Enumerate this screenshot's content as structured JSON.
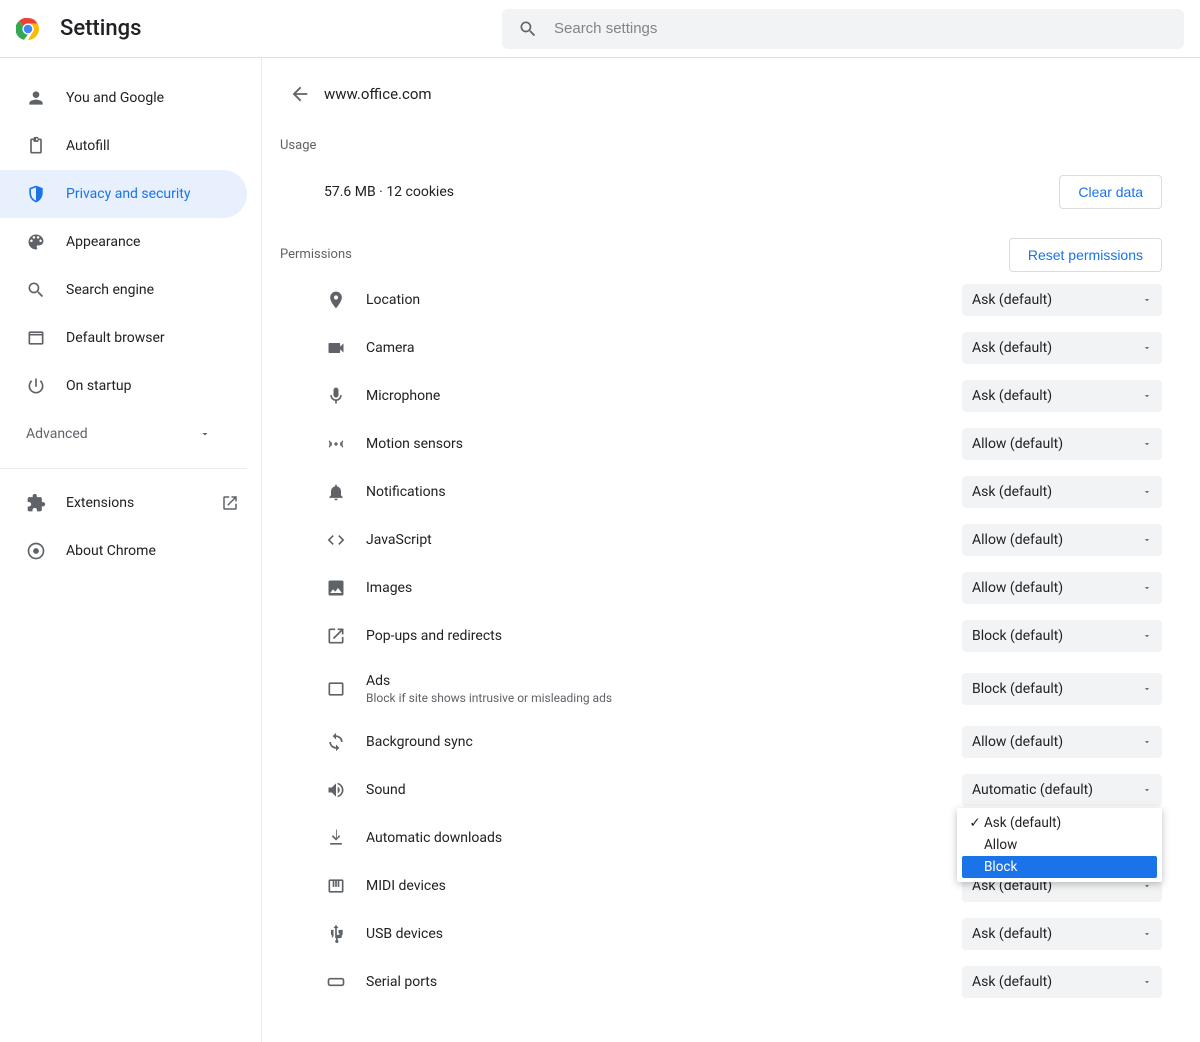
{
  "header": {
    "title": "Settings",
    "search_placeholder": "Search settings"
  },
  "sidebar": {
    "items": [
      {
        "id": "you",
        "label": "You and Google",
        "icon": "person-icon"
      },
      {
        "id": "autofill",
        "label": "Autofill",
        "icon": "clipboard-icon"
      },
      {
        "id": "privacy",
        "label": "Privacy and security",
        "icon": "shield-icon",
        "active": true
      },
      {
        "id": "appearance",
        "label": "Appearance",
        "icon": "palette-icon"
      },
      {
        "id": "search-engine",
        "label": "Search engine",
        "icon": "search-icon"
      },
      {
        "id": "default-browser",
        "label": "Default browser",
        "icon": "window-icon"
      },
      {
        "id": "startup",
        "label": "On startup",
        "icon": "power-icon"
      }
    ],
    "advanced_label": "Advanced",
    "extensions_label": "Extensions",
    "about_label": "About Chrome"
  },
  "main": {
    "site": "www.office.com",
    "usage": {
      "title": "Usage",
      "storage": "57.6 MB · 12 cookies",
      "clear_btn": "Clear data"
    },
    "permissions": {
      "title": "Permissions",
      "reset_btn": "Reset permissions",
      "items": [
        {
          "id": "location",
          "label": "Location",
          "value": "Ask (default)",
          "icon": "location-icon"
        },
        {
          "id": "camera",
          "label": "Camera",
          "value": "Ask (default)",
          "icon": "camera-icon"
        },
        {
          "id": "microphone",
          "label": "Microphone",
          "value": "Ask (default)",
          "icon": "mic-icon"
        },
        {
          "id": "motion",
          "label": "Motion sensors",
          "value": "Allow (default)",
          "icon": "motion-icon"
        },
        {
          "id": "notifications",
          "label": "Notifications",
          "value": "Ask (default)",
          "icon": "bell-icon"
        },
        {
          "id": "javascript",
          "label": "JavaScript",
          "value": "Allow (default)",
          "icon": "code-icon"
        },
        {
          "id": "images",
          "label": "Images",
          "value": "Allow (default)",
          "icon": "image-icon"
        },
        {
          "id": "popups",
          "label": "Pop-ups and redirects",
          "value": "Block (default)",
          "icon": "popup-icon"
        },
        {
          "id": "ads",
          "label": "Ads",
          "sub": "Block if site shows intrusive or misleading ads",
          "value": "Block (default)",
          "icon": "ads-icon"
        },
        {
          "id": "bgsync",
          "label": "Background sync",
          "value": "Allow (default)",
          "icon": "sync-icon"
        },
        {
          "id": "sound",
          "label": "Sound",
          "value": "Automatic (default)",
          "icon": "sound-icon"
        },
        {
          "id": "autodl",
          "label": "Automatic downloads",
          "value": "Ask (default)",
          "icon": "download-icon",
          "open": true
        },
        {
          "id": "midi",
          "label": "MIDI devices",
          "value": "Ask (default)",
          "icon": "midi-icon"
        },
        {
          "id": "usb",
          "label": "USB devices",
          "value": "Ask (default)",
          "icon": "usb-icon"
        },
        {
          "id": "serial",
          "label": "Serial ports",
          "value": "Ask (default)",
          "icon": "serial-icon"
        }
      ],
      "dropdown_options": [
        {
          "label": "Ask (default)",
          "checked": true
        },
        {
          "label": "Allow"
        },
        {
          "label": "Block",
          "highlight": true
        }
      ]
    }
  }
}
